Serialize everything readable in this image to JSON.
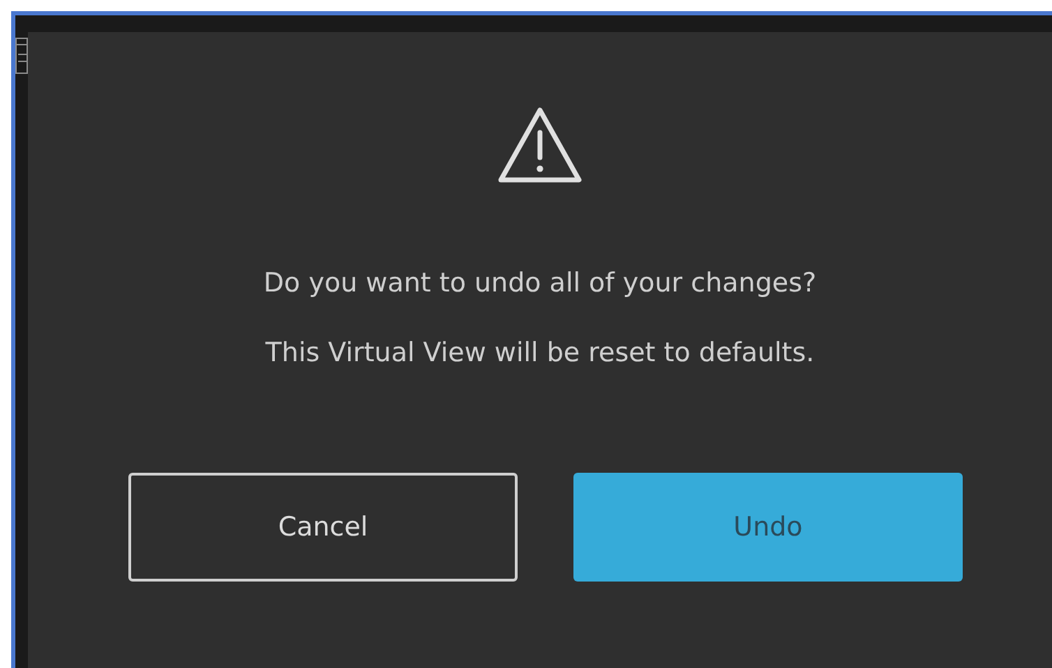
{
  "dialog": {
    "message": "Do you want to undo all of your changes?",
    "detail": "This Virtual View will be reset to defaults.",
    "buttons": [
      {
        "label": "Cancel",
        "kind": "secondary"
      },
      {
        "label": "Undo",
        "kind": "primary"
      }
    ]
  }
}
